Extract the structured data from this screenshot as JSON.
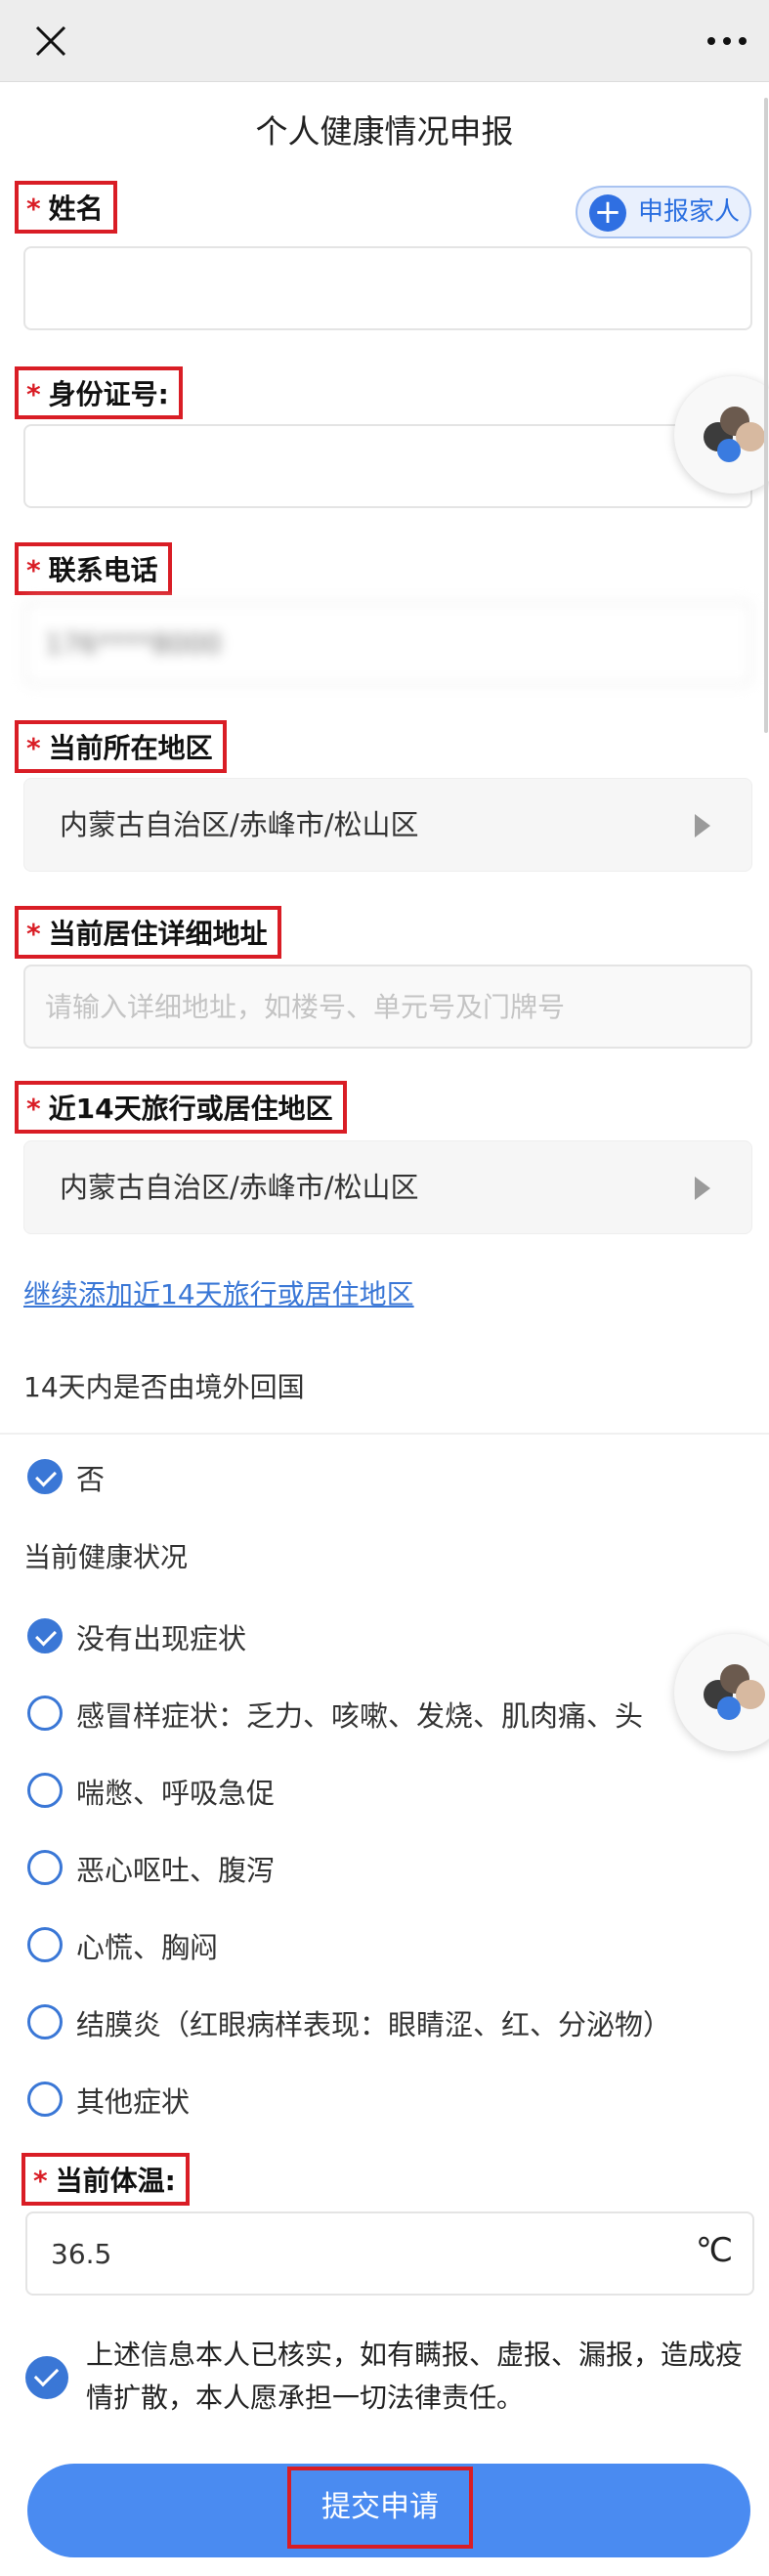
{
  "window": {
    "close_icon": "close-icon",
    "more_icon": "more-icon"
  },
  "page_title": "个人健康情况申报",
  "family_button": {
    "label": "申报家人",
    "icon": "plus-circle-icon"
  },
  "required_mark": "*",
  "fields": {
    "name": {
      "label": "姓名",
      "value": ""
    },
    "id_number": {
      "label": "身份证号:",
      "value": ""
    },
    "phone": {
      "label": "联系电话",
      "value": "176****8000"
    },
    "current_region": {
      "label": "当前所在地区",
      "value": "内蒙古自治区/赤峰市/松山区"
    },
    "address": {
      "label": "当前居住详细地址",
      "placeholder": "请输入详细地址，如楼号、单元号及门牌号",
      "value": ""
    },
    "travel_region": {
      "label": "近14天旅行或居住地区",
      "value": "内蒙古自治区/赤峰市/松山区"
    }
  },
  "add_travel_link": "继续添加近14天旅行或居住地区",
  "abroad_question": {
    "label": "14天内是否由境外回国",
    "options": [
      {
        "label": "否",
        "checked": true
      }
    ]
  },
  "health_status": {
    "label": "当前健康状况",
    "options": [
      {
        "label": "没有出现症状",
        "checked": true
      },
      {
        "label": "感冒样症状：乏力、咳嗽、发烧、肌肉痛、头",
        "checked": false
      },
      {
        "label": "喘憋、呼吸急促",
        "checked": false
      },
      {
        "label": "恶心呕吐、腹泻",
        "checked": false
      },
      {
        "label": "心慌、胸闷",
        "checked": false
      },
      {
        "label": "结膜炎（红眼病样表现：眼睛涩、红、分泌物）",
        "checked": false
      },
      {
        "label": "其他症状",
        "checked": false
      }
    ]
  },
  "temperature": {
    "label": "当前体温:",
    "value": "36.5",
    "unit": "℃"
  },
  "agreement": {
    "checked": true,
    "text": "上述信息本人已核实，如有瞒报、虚报、漏报，造成疫情扩散，本人愿承担一切法律责任。"
  },
  "submit_label": "提交申请",
  "colors": {
    "accent": "#4a8bf1",
    "highlight_red": "#d91d25",
    "link": "#3a77d6"
  }
}
